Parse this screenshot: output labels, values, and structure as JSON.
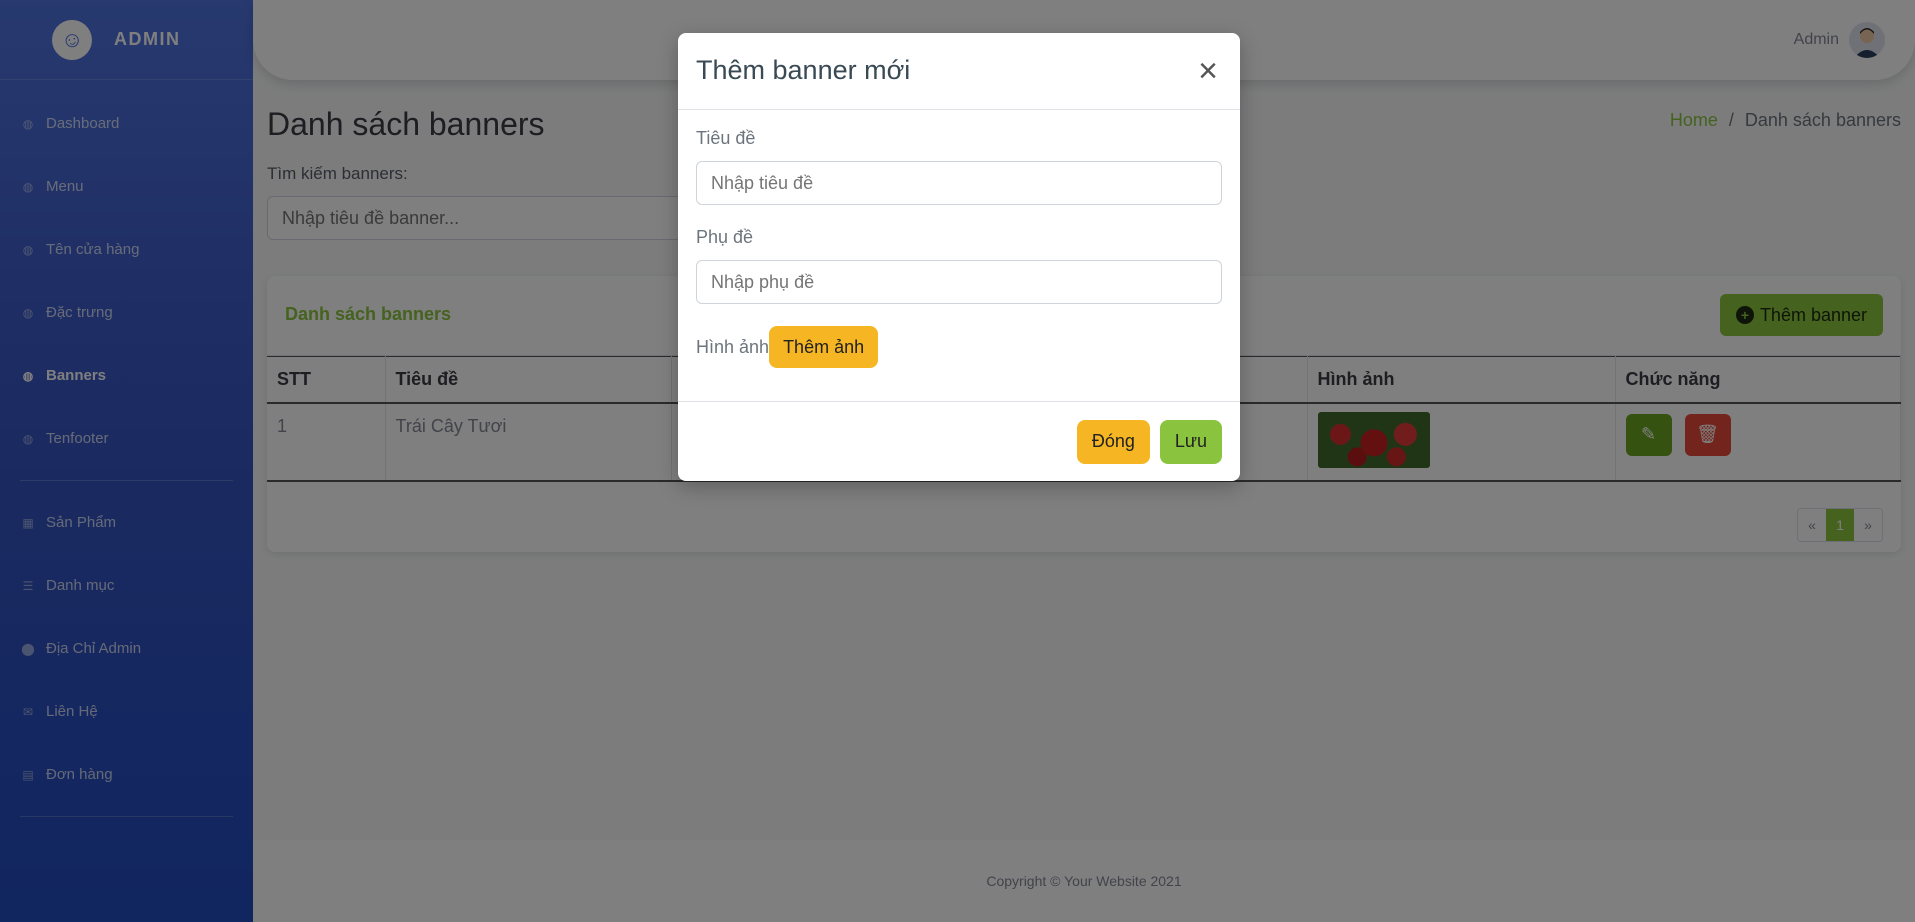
{
  "brand": {
    "text": "ADMIN",
    "icon": "laugh-wink-icon"
  },
  "sidebar": {
    "items": [
      {
        "label": "Dashboard",
        "icon": "gauge-icon",
        "active": false
      },
      {
        "label": "Menu",
        "icon": "gauge-icon",
        "active": false
      },
      {
        "label": "Tên cửa hàng",
        "icon": "gauge-icon",
        "active": false
      },
      {
        "label": "Đặc trưng",
        "icon": "gauge-icon",
        "active": false
      },
      {
        "label": "Banners",
        "icon": "gauge-icon",
        "active": true
      },
      {
        "label": "Tenfooter",
        "icon": "gauge-icon",
        "active": false
      },
      {
        "label": "Sản Phẩm",
        "icon": "box-icon",
        "active": false
      },
      {
        "label": "Danh mục",
        "icon": "list-icon",
        "active": false
      },
      {
        "label": "Địa Chỉ Admin",
        "icon": "map-marker-icon",
        "active": false
      },
      {
        "label": "Liên Hệ",
        "icon": "envelope-icon",
        "active": false
      },
      {
        "label": "Đơn hàng",
        "icon": "id-card-icon",
        "active": false
      }
    ]
  },
  "topbar": {
    "user_name": "Admin"
  },
  "page": {
    "title": "Danh sách banners",
    "breadcrumb": {
      "home": "Home",
      "separator": "/",
      "current": "Danh sách banners"
    },
    "search_label": "Tìm kiếm banners:",
    "search_placeholder": "Nhập tiêu đề banner..."
  },
  "card": {
    "title": "Danh sách banners",
    "add_button": "Thêm banner",
    "columns": [
      "STT",
      "Tiêu đề",
      "Hình ảnh",
      "Chức năng"
    ],
    "rows": [
      {
        "stt": "1",
        "title": "Trái Cây Tươi"
      }
    ],
    "pagination": {
      "prev": "«",
      "current": "1",
      "next": "»"
    }
  },
  "footer": {
    "text": "Copyright © Your Website 2021"
  },
  "modal": {
    "title": "Thêm banner mới",
    "close_symbol": "×",
    "title_label": "Tiêu đề",
    "title_placeholder": "Nhập tiêu đề",
    "subtitle_label": "Phụ đề",
    "subtitle_placeholder": "Nhập phụ đề",
    "image_label": "Hình ảnh",
    "upload_button": "Thêm ảnh",
    "close_button": "Đóng",
    "save_button": "Lưu"
  },
  "colors": {
    "sidebar": "#4e73df",
    "accent": "#8ac43f",
    "warning": "#f6b623",
    "danger": "#e74a3b"
  }
}
